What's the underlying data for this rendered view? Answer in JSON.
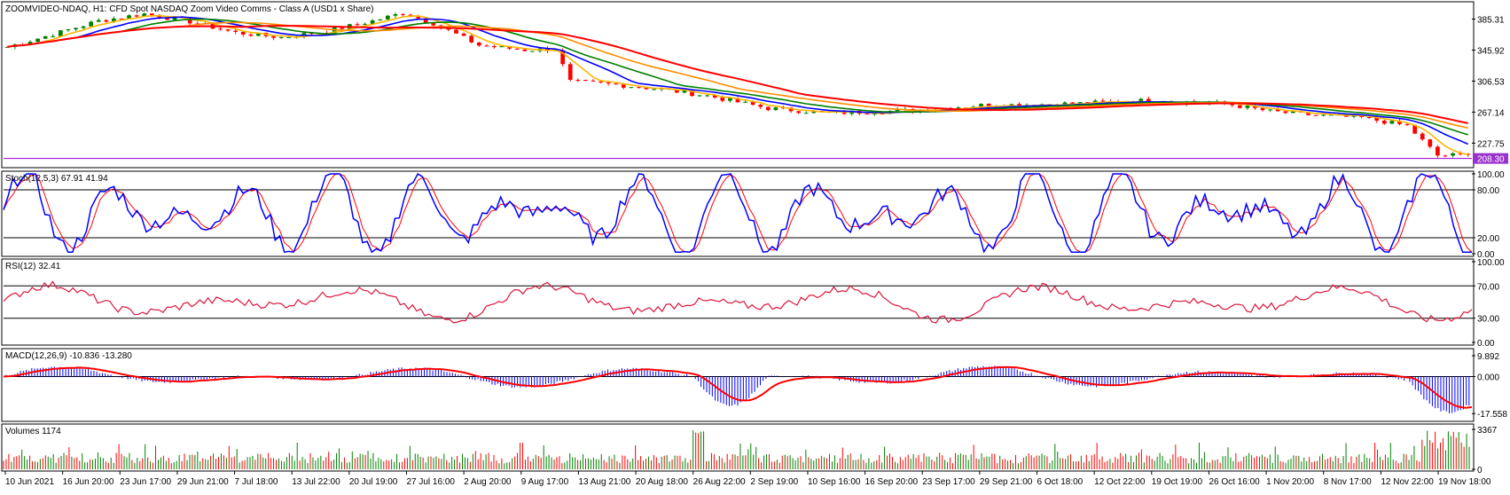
{
  "chart_data": {
    "type": "line",
    "symbol_title": "ZOOMVIDEO-NDAQ, H1:  CFD Spot NASDAQ Zoom Video Comms - Class A (USD1 x Share)",
    "x_labels": [
      "10 Jun 2021",
      "16 Jun 20:00",
      "23 Jun 17:00",
      "29 Jun 21:00",
      "7 Jul 18:00",
      "13 Jul 22:00",
      "20 Jul 19:00",
      "27 Jul 16:00",
      "2 Aug 20:00",
      "9 Aug 17:00",
      "13 Aug 21:00",
      "20 Aug 18:00",
      "26 Aug 22:00",
      "2 Sep 19:00",
      "10 Sep 16:00",
      "16 Sep 20:00",
      "23 Sep 17:00",
      "29 Sep 21:00",
      "6 Oct 18:00",
      "12 Oct 22:00",
      "19 Oct 19:00",
      "26 Oct 16:00",
      "1 Nov 20:00",
      "8 Nov 17:00",
      "12 Nov 22:00",
      "19 Nov 18:00"
    ],
    "main": {
      "y_ticks": [
        "385.31",
        "345.92",
        "306.53",
        "267.14",
        "227.75"
      ],
      "ylim": [
        200,
        405
      ],
      "current_price": "208.30",
      "price_anchors": [
        [
          0,
          350
        ],
        [
          6,
          366
        ],
        [
          12,
          383
        ],
        [
          18,
          392
        ],
        [
          24,
          382
        ],
        [
          30,
          368
        ],
        [
          36,
          362
        ],
        [
          42,
          370
        ],
        [
          48,
          383
        ],
        [
          52,
          393
        ],
        [
          56,
          380
        ],
        [
          62,
          352
        ],
        [
          68,
          346
        ],
        [
          72,
          347
        ],
        [
          74,
          306
        ],
        [
          80,
          302
        ],
        [
          86,
          296
        ],
        [
          92,
          288
        ],
        [
          100,
          272
        ],
        [
          108,
          266
        ],
        [
          118,
          269
        ],
        [
          128,
          276
        ],
        [
          140,
          278
        ],
        [
          150,
          282
        ],
        [
          160,
          278
        ],
        [
          166,
          268
        ],
        [
          172,
          263
        ],
        [
          178,
          260
        ],
        [
          184,
          250
        ],
        [
          188,
          212
        ],
        [
          192,
          213
        ]
      ],
      "ma_colors": [
        "#ffb600",
        "#0000ff",
        "#008000",
        "#ff8c00",
        "#ff0000"
      ]
    },
    "stochastic": {
      "label": "Stoch(12,5,3) 67.91 41.94",
      "y_ticks": [
        "100.00",
        "80.00",
        "20.00",
        "0.00"
      ],
      "levels": [
        80,
        20
      ],
      "colors": [
        "#0000ff",
        "#ff0000"
      ]
    },
    "rsi": {
      "label": "RSI(12) 32.41",
      "y_ticks": [
        "100.00",
        "70.00",
        "30.00",
        "0.00"
      ],
      "levels": [
        70,
        30
      ],
      "color": "#dc143c"
    },
    "macd": {
      "label": "MACD(12,26,9) -10.836 -13.280",
      "y_ticks": [
        "9.892",
        "0.000",
        "-17.558"
      ],
      "ylim": [
        -20,
        12
      ],
      "colors": [
        "#0000ff",
        "#ff0000"
      ]
    },
    "volumes": {
      "label": "Volumes 1174",
      "y_ticks": [
        "3367",
        "0"
      ],
      "ylim": [
        0,
        3600
      ],
      "colors": [
        "#008000",
        "#ff0000"
      ]
    }
  }
}
